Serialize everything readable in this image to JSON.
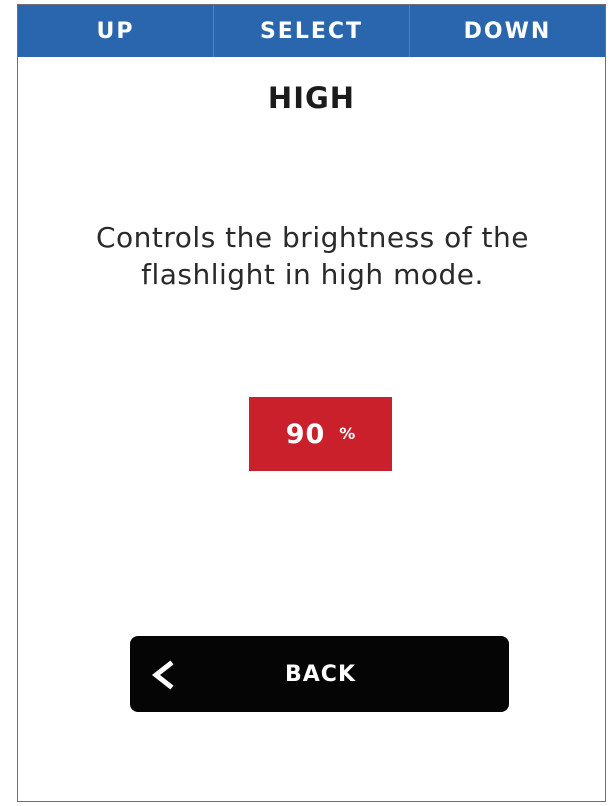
{
  "navigation": {
    "up_label": "UP",
    "select_label": "SELECT",
    "down_label": "DOWN"
  },
  "screen": {
    "title": "HIGH",
    "description": "Controls the brightness of the flashlight in high mode."
  },
  "setting": {
    "value": "90",
    "unit": "%"
  },
  "back_button": {
    "label": "BACK",
    "icon": "chevron-left-icon"
  },
  "colors": {
    "nav_bar": "#2a66ad",
    "value_box": "#c9202b",
    "back_button": "#050505"
  }
}
